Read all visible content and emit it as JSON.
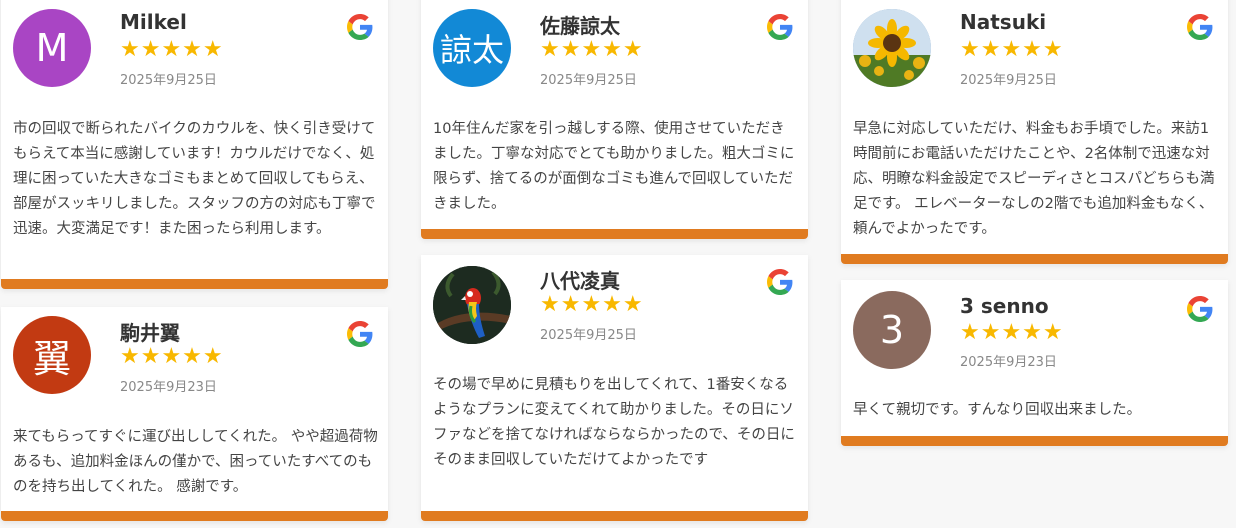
{
  "accent": "#e07b20",
  "star_color": "#f8b800",
  "reviews": [
    {
      "name": "Milkel",
      "avatar_text": "M",
      "avatar_color": "#a945c4",
      "rating": "★★★★★",
      "date": "2025年9月25日",
      "text": "市の回収で断られたバイクのカウルを、快く引き受けてもらえて本当に感謝しています！カウルだけでなく、処理に困っていた大きなゴミもまとめて回収してもらえ、部屋がスッキリしました。スタッフの方の対応も丁寧で迅速。大変満足です！また困ったら利用します。"
    },
    {
      "name": "駒井翼",
      "avatar_text": "翼",
      "avatar_color": "#c23a12",
      "rating": "★★★★★",
      "date": "2025年9月23日",
      "text": "来てもらってすぐに運び出ししてくれた。 やや超過荷物あるも、追加料金ほんの僅かで、困っていたすべてのものを持ち出してくれた。 感謝です。"
    },
    {
      "name": "佐藤諒太",
      "avatar_text": "諒太",
      "avatar_color": "#1289d6",
      "rating": "★★★★★",
      "date": "2025年9月25日",
      "text": "10年住んだ家を引っ越しする際、使用させていただきました。丁寧な対応でとても助かりました。粗大ゴミに限らず、捨てるのが面倒なゴミも進んで回収していただきました。"
    },
    {
      "name": "八代凌真",
      "avatar_text": "",
      "avatar_color": "#1e2a22",
      "rating": "★★★★★",
      "date": "2025年9月25日",
      "text": "その場で早めに見積もりを出してくれて、1番安くなるようなプランに変えてくれて助かりました。その日にソファなどを捨てなければならならかったので、その日にそのまま回収していただけてよかったです"
    },
    {
      "name": "Natsuki",
      "avatar_text": "",
      "avatar_color": "#6b8f2a",
      "rating": "★★★★★",
      "date": "2025年9月25日",
      "text": "早急に対応していただけ、料金もお手頃でした。来訪1時間前にお電話いただけたことや、2名体制で迅速な対応、明瞭な料金設定でスピーディさとコスパどちらも満足です。 エレベーターなしの2階でも追加料金もなく、頼んでよかったです。"
    },
    {
      "name": "3 senno",
      "avatar_text": "3",
      "avatar_color": "#8a6a5e",
      "rating": "★★★★★",
      "date": "2025年9月23日",
      "text": "早くて親切です。すんなり回収出来ました。"
    }
  ]
}
